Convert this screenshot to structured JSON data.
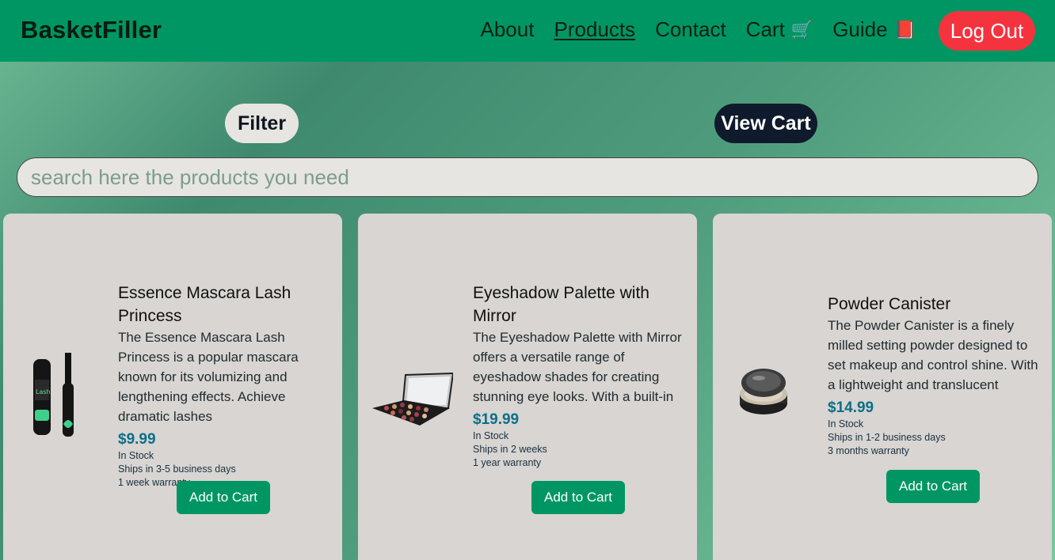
{
  "brand": "BasketFiller",
  "nav": {
    "about": "About",
    "products": "Products",
    "contact": "Contact",
    "cart": "Cart",
    "cart_emoji": "🛒",
    "guide": "Guide",
    "guide_emoji": "📕",
    "logout": "Log Out"
  },
  "toolbar": {
    "filter": "Filter",
    "view_cart": "View Cart"
  },
  "search": {
    "placeholder": "search here the products you need",
    "value": ""
  },
  "colors": {
    "nav_bg": "#009663",
    "logout_bg": "#f4333f",
    "view_cart_bg": "#0f1a2c",
    "price": "#0c6f88",
    "add_button": "#009663"
  },
  "products": [
    {
      "title": "Essence Mascara Lash Princess",
      "description": "The Essence Mascara Lash Princess is a popular mascara known for its volumizing and lengthening effects. Achieve dramatic lashes",
      "price": "$9.99",
      "stock": "In Stock",
      "shipping": "Ships in 3-5 business days",
      "warranty": "1 week warranty",
      "button": "Add to Cart",
      "image": "mascara"
    },
    {
      "title": "Eyeshadow Palette with Mirror",
      "description": "The Eyeshadow Palette with Mirror offers a versatile range of eyeshadow shades for creating stunning eye looks. With a built-in",
      "price": "$19.99",
      "stock": "In Stock",
      "shipping": "Ships in 2 weeks",
      "warranty": "1 year warranty",
      "button": "Add to Cart",
      "image": "eyeshadow-palette"
    },
    {
      "title": "Powder Canister",
      "description": "The Powder Canister is a finely milled setting powder designed to set makeup and control shine. With a lightweight and translucent",
      "price": "$14.99",
      "stock": "In Stock",
      "shipping": "Ships in 1-2 business days",
      "warranty": "3 months warranty",
      "button": "Add to Cart",
      "image": "powder-canister"
    }
  ]
}
